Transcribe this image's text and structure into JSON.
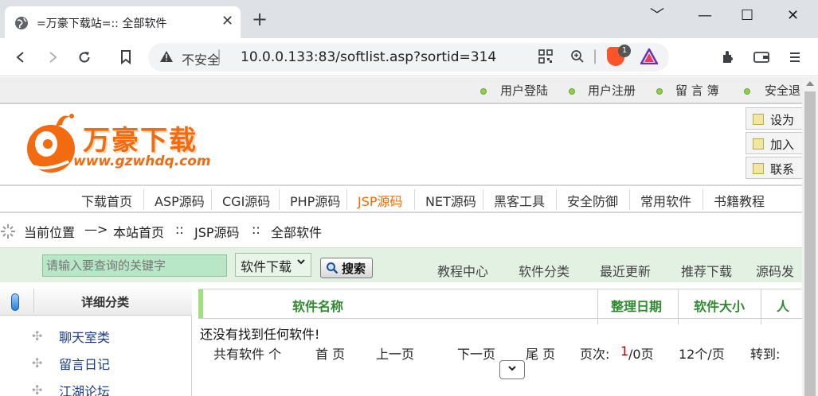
{
  "browser": {
    "tab_title": "=万豪下载站=:: 全部软件",
    "tab_close": "✕",
    "new_tab": "+",
    "window_controls": [
      "﹀",
      "—",
      "☐",
      "✕"
    ],
    "security_label": "不安全",
    "security_sep": "|",
    "url": "10.0.0.133:83/softlist.asp?sortid=314",
    "brave_badge": "1"
  },
  "top_links": [
    "用户登陆",
    "用户注册",
    "留 言 簿",
    "安全退"
  ],
  "logo": {
    "name": "万豪下载",
    "url": "www.gzwhdq.com"
  },
  "side_buttons": [
    "设为",
    "加入",
    "联系"
  ],
  "nav": {
    "items": [
      "下载首页",
      "ASP源码",
      "CGI源码",
      "PHP源码",
      "JSP源码",
      "NET源码",
      "黑客工具",
      "安全防御",
      "常用软件",
      "书籍教程"
    ],
    "active_index": 4
  },
  "breadcrumb": {
    "label": "当前位置",
    "arrow": "—>",
    "home": "本站首页",
    "sep1": "::",
    "category": "JSP源码",
    "sep2": "::",
    "current": "全部软件"
  },
  "search": {
    "placeholder": "请输入要查询的关键字",
    "select_value": "软件下载",
    "button_label": "搜索",
    "sublinks": [
      "教程中心",
      "软件分类",
      "最近更新",
      "推荐下载",
      "源码发"
    ]
  },
  "sidebar": {
    "title": "详细分类",
    "items": [
      "聊天室类",
      "留言日记",
      "江湖论坛"
    ]
  },
  "results": {
    "columns": [
      "软件名称",
      "整理日期",
      "软件大小",
      "人"
    ],
    "empty_message": "还没有找到任何软件!",
    "pager": {
      "total_label": "共有软件 个",
      "first": "首 页",
      "prev": "上一页",
      "next": "下一页",
      "last": "尾 页",
      "page_label": "页次:",
      "page_current": "1",
      "page_total": "/0页",
      "per_page": "12个/页",
      "goto": "转到:"
    }
  }
}
